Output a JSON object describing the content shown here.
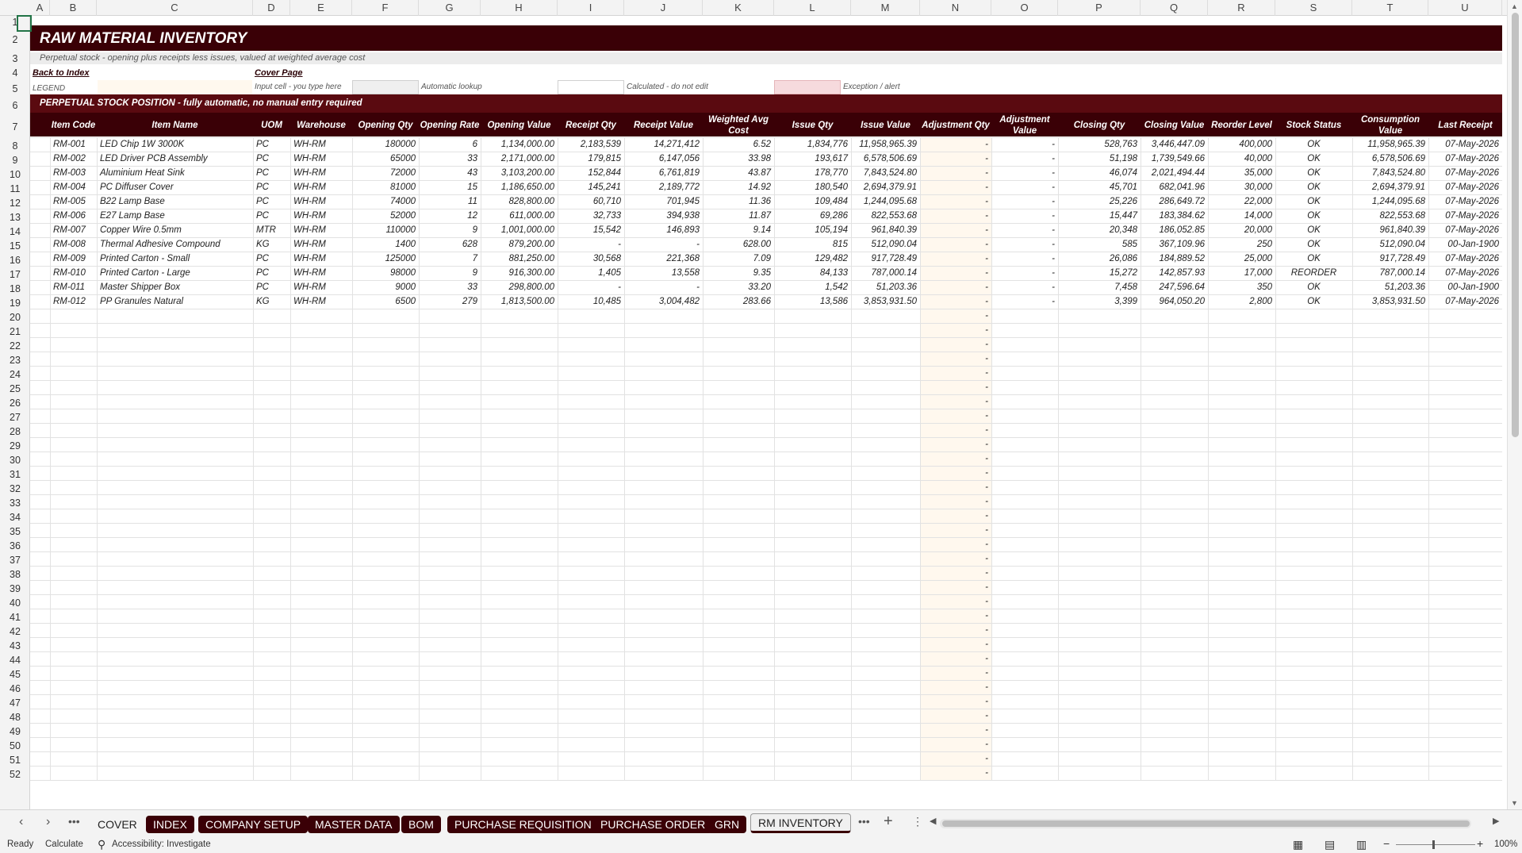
{
  "columns": [
    "A",
    "B",
    "C",
    "D",
    "E",
    "F",
    "G",
    "H",
    "I",
    "J",
    "K",
    "L",
    "M",
    "N",
    "O",
    "P",
    "Q",
    "R",
    "S",
    "T",
    "U"
  ],
  "rows_visible": [
    "1",
    "2",
    "3",
    "4",
    "5",
    "6",
    "7",
    "8",
    "9",
    "10",
    "11",
    "12",
    "13",
    "14",
    "15",
    "16",
    "17",
    "18",
    "19",
    "20",
    "21",
    "22",
    "23",
    "24",
    "25",
    "26",
    "27",
    "28",
    "29",
    "30",
    "31",
    "32",
    "33",
    "34",
    "35",
    "36",
    "37",
    "38",
    "39",
    "40",
    "41",
    "42",
    "43",
    "44",
    "45",
    "46",
    "47",
    "48",
    "49",
    "50",
    "51",
    "52"
  ],
  "sheet": {
    "title": "RAW MATERIAL INVENTORY",
    "subtitle": "Perpetual stock - opening plus receipts less issues, valued at weighted average cost",
    "back_link": "Back to Index",
    "cover_link": "Cover Page",
    "legend_label": "LEGEND",
    "legend_items": [
      "Input cell - you type here",
      "Automatic lookup",
      "Calculated - do not edit",
      "Exception / alert"
    ],
    "section_header": "PERPETUAL STOCK POSITION - fully automatic, no manual entry required",
    "headers": [
      "Item Code",
      "Item Name",
      "UOM",
      "Warehouse",
      "Opening Qty",
      "Opening Rate",
      "Opening Value",
      "Receipt Qty",
      "Receipt Value",
      "Weighted Avg Cost",
      "Issue Qty",
      "Issue Value",
      "Adjustment Qty",
      "Adjustment Value",
      "Closing Qty",
      "Closing Value",
      "Reorder Level",
      "Stock Status",
      "Consumption Value",
      "Last Receipt"
    ],
    "rows": [
      [
        "RM-001",
        "LED Chip 1W 3000K",
        "PC",
        "WH-RM",
        "180000",
        "6",
        "1,134,000.00",
        "2,183,539",
        "14,271,412",
        "6.52",
        "1,834,776",
        "11,958,965.39",
        "-",
        "-",
        "528,763",
        "3,446,447.09",
        "400,000",
        "OK",
        "11,958,965.39",
        "07-May-2026"
      ],
      [
        "RM-002",
        "LED Driver PCB Assembly",
        "PC",
        "WH-RM",
        "65000",
        "33",
        "2,171,000.00",
        "179,815",
        "6,147,056",
        "33.98",
        "193,617",
        "6,578,506.69",
        "-",
        "-",
        "51,198",
        "1,739,549.66",
        "40,000",
        "OK",
        "6,578,506.69",
        "07-May-2026"
      ],
      [
        "RM-003",
        "Aluminium Heat Sink",
        "PC",
        "WH-RM",
        "72000",
        "43",
        "3,103,200.00",
        "152,844",
        "6,761,819",
        "43.87",
        "178,770",
        "7,843,524.80",
        "-",
        "-",
        "46,074",
        "2,021,494.44",
        "35,000",
        "OK",
        "7,843,524.80",
        "07-May-2026"
      ],
      [
        "RM-004",
        "PC Diffuser Cover",
        "PC",
        "WH-RM",
        "81000",
        "15",
        "1,186,650.00",
        "145,241",
        "2,189,772",
        "14.92",
        "180,540",
        "2,694,379.91",
        "-",
        "-",
        "45,701",
        "682,041.96",
        "30,000",
        "OK",
        "2,694,379.91",
        "07-May-2026"
      ],
      [
        "RM-005",
        "B22 Lamp Base",
        "PC",
        "WH-RM",
        "74000",
        "11",
        "828,800.00",
        "60,710",
        "701,945",
        "11.36",
        "109,484",
        "1,244,095.68",
        "-",
        "-",
        "25,226",
        "286,649.72",
        "22,000",
        "OK",
        "1,244,095.68",
        "07-May-2026"
      ],
      [
        "RM-006",
        "E27 Lamp Base",
        "PC",
        "WH-RM",
        "52000",
        "12",
        "611,000.00",
        "32,733",
        "394,938",
        "11.87",
        "69,286",
        "822,553.68",
        "-",
        "-",
        "15,447",
        "183,384.62",
        "14,000",
        "OK",
        "822,553.68",
        "07-May-2026"
      ],
      [
        "RM-007",
        "Copper Wire 0.5mm",
        "MTR",
        "WH-RM",
        "110000",
        "9",
        "1,001,000.00",
        "15,542",
        "146,893",
        "9.14",
        "105,194",
        "961,840.39",
        "-",
        "-",
        "20,348",
        "186,052.85",
        "20,000",
        "OK",
        "961,840.39",
        "07-May-2026"
      ],
      [
        "RM-008",
        "Thermal Adhesive Compound",
        "KG",
        "WH-RM",
        "1400",
        "628",
        "879,200.00",
        "-",
        "-",
        "628.00",
        "815",
        "512,090.04",
        "-",
        "-",
        "585",
        "367,109.96",
        "250",
        "OK",
        "512,090.04",
        "00-Jan-1900"
      ],
      [
        "RM-009",
        "Printed Carton - Small",
        "PC",
        "WH-RM",
        "125000",
        "7",
        "881,250.00",
        "30,568",
        "221,368",
        "7.09",
        "129,482",
        "917,728.49",
        "-",
        "-",
        "26,086",
        "184,889.52",
        "25,000",
        "OK",
        "917,728.49",
        "07-May-2026"
      ],
      [
        "RM-010",
        "Printed Carton - Large",
        "PC",
        "WH-RM",
        "98000",
        "9",
        "916,300.00",
        "1,405",
        "13,558",
        "9.35",
        "84,133",
        "787,000.14",
        "-",
        "-",
        "15,272",
        "142,857.93",
        "17,000",
        "REORDER",
        "787,000.14",
        "07-May-2026"
      ],
      [
        "RM-011",
        "Master Shipper Box",
        "PC",
        "WH-RM",
        "9000",
        "33",
        "298,800.00",
        "-",
        "-",
        "33.20",
        "1,542",
        "51,203.36",
        "-",
        "-",
        "7,458",
        "247,596.64",
        "350",
        "OK",
        "51,203.36",
        "00-Jan-1900"
      ],
      [
        "RM-012",
        "PP Granules Natural",
        "KG",
        "WH-RM",
        "6500",
        "279",
        "1,813,500.00",
        "10,485",
        "3,004,482",
        "283.66",
        "13,586",
        "3,853,931.50",
        "-",
        "-",
        "3,399",
        "964,050.20",
        "2,800",
        "OK",
        "3,853,931.50",
        "07-May-2026"
      ]
    ],
    "empty_row_dash": "-"
  },
  "tabs": [
    "COVER",
    "INDEX",
    "COMPANY SETUP",
    "MASTER DATA",
    "BOM",
    "PURCHASE REQUISITION",
    "PURCHASE ORDER",
    "GRN",
    "RM INVENTORY"
  ],
  "status": {
    "ready": "Ready",
    "calculate": "Calculate",
    "accessibility": "Accessibility: Investigate",
    "zoom": "100%"
  },
  "colors": {
    "band": "#3a0006",
    "input": "#fff8ee",
    "lookup": "#efefef",
    "alert": "#f6dadd",
    "adj_col": "#fff8ee"
  }
}
